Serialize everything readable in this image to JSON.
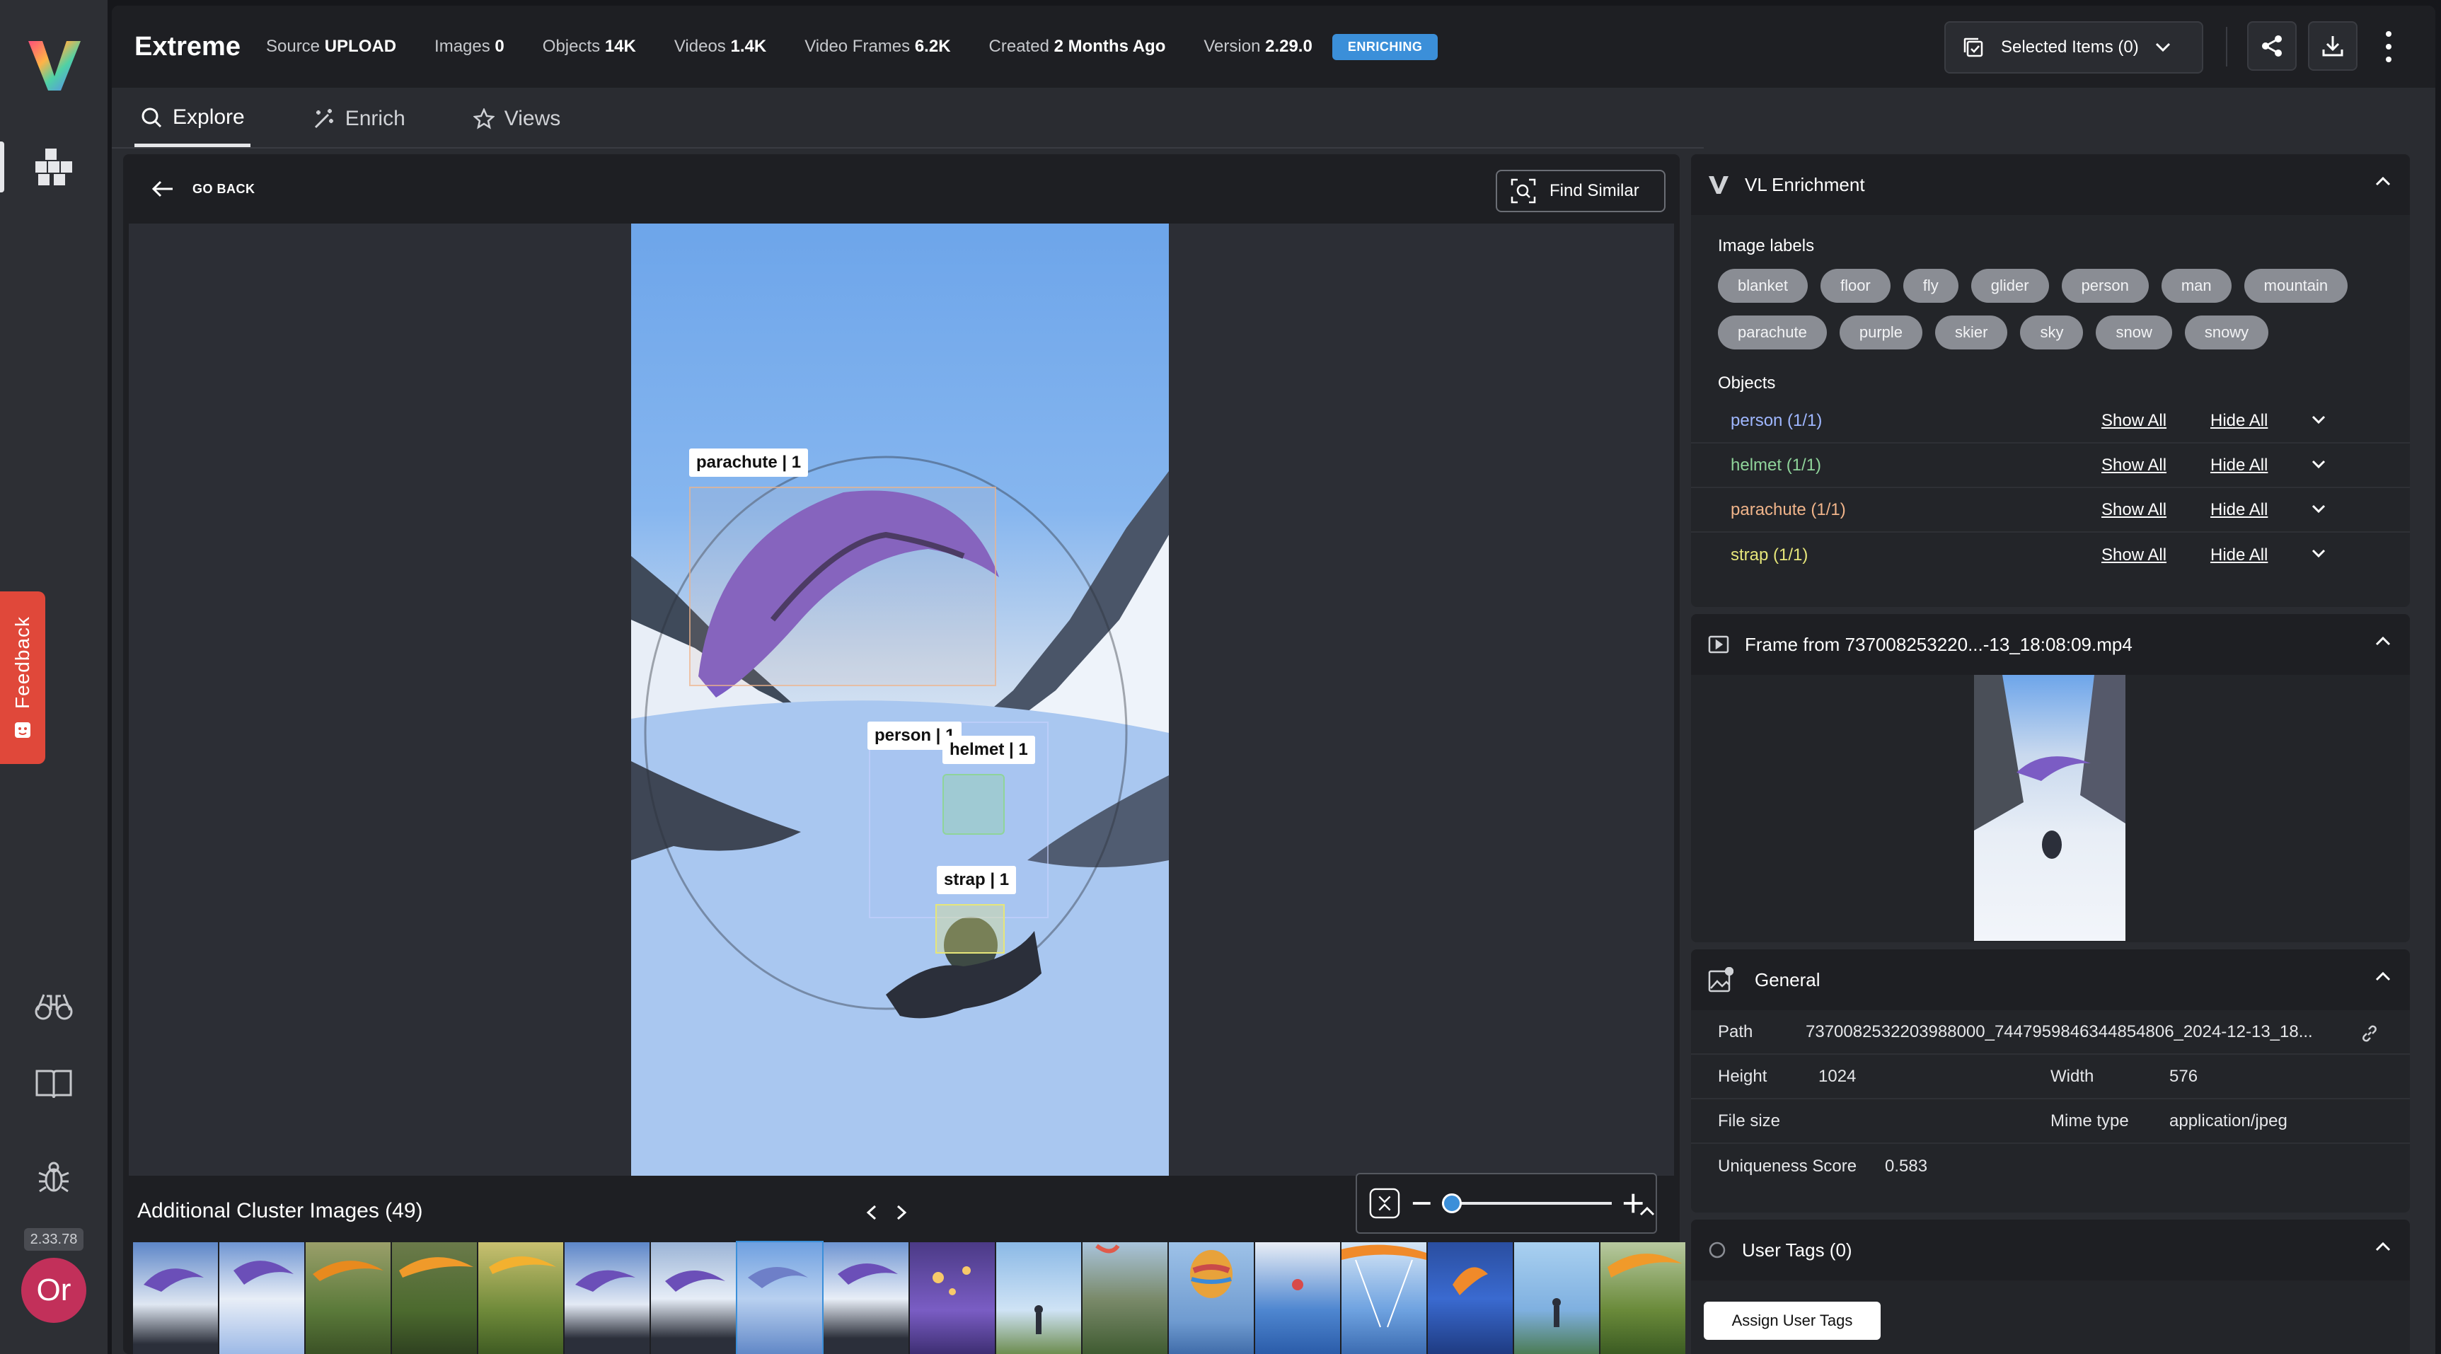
{
  "app": {
    "version": "2.33.78",
    "avatar_initials": "Or",
    "feedback_label": "Feedback"
  },
  "dataset": {
    "name": "Extreme",
    "meta": [
      {
        "label": "Source",
        "value": "UPLOAD"
      },
      {
        "label": "Images",
        "value": "0"
      },
      {
        "label": "Objects",
        "value": "14K"
      },
      {
        "label": "Videos",
        "value": "1.4K"
      },
      {
        "label": "Video Frames",
        "value": "6.2K"
      },
      {
        "label": "Created",
        "value": "2 Months Ago"
      },
      {
        "label": "Version",
        "value": "2.29.0"
      }
    ],
    "status_badge": "ENRICHING"
  },
  "toolbar": {
    "selected_items_label": "Selected Items (0)"
  },
  "tabs": [
    {
      "label": "Explore",
      "active": true
    },
    {
      "label": "Enrich",
      "active": false
    },
    {
      "label": "Views",
      "active": false
    }
  ],
  "viewer": {
    "go_back_label": "GO BACK",
    "find_similar_label": "Find Similar",
    "annotations": [
      {
        "label": "parachute | 1"
      },
      {
        "label": "person | 1"
      },
      {
        "label": "helmet | 1"
      },
      {
        "label": "strap | 1"
      }
    ],
    "zoom_level": 0.0
  },
  "cluster": {
    "title": "Additional Cluster Images (49)"
  },
  "enrichment": {
    "title": "VL Enrichment",
    "image_labels_title": "Image labels",
    "image_labels": [
      "blanket",
      "floor",
      "fly",
      "glider",
      "person",
      "man",
      "mountain",
      "parachute",
      "purple",
      "skier",
      "sky",
      "snow",
      "snowy"
    ],
    "objects_title": "Objects",
    "objects": [
      {
        "name": "person (1/1)",
        "color": "#9fb7ff",
        "show": "Show All",
        "hide": "Hide All"
      },
      {
        "name": "helmet (1/1)",
        "color": "#8fd49a",
        "show": "Show All",
        "hide": "Hide All"
      },
      {
        "name": "parachute (1/1)",
        "color": "#f0b48a",
        "show": "Show All",
        "hide": "Hide All"
      },
      {
        "name": "strap (1/1)",
        "color": "#e6e67a",
        "show": "Show All",
        "hide": "Hide All"
      }
    ]
  },
  "frame_panel": {
    "title": "Frame from 737008253220...-13_18:08:09.mp4"
  },
  "general": {
    "title": "General",
    "path_label": "Path",
    "path_value": "7370082532203988000_7447959846344854806_2024-12-13_18...",
    "height_label": "Height",
    "height_value": "1024",
    "width_label": "Width",
    "width_value": "576",
    "file_size_label": "File size",
    "mime_label": "Mime type",
    "mime_value": "application/jpeg",
    "uniqueness_label": "Uniqueness Score",
    "uniqueness_value": "0.583"
  },
  "user_tags": {
    "title": "User Tags (0)",
    "assign_label": "Assign User Tags"
  },
  "colors": {
    "accent": "#3b8fd9",
    "feedback": "#e0483a",
    "avatar": "#c2305a"
  }
}
